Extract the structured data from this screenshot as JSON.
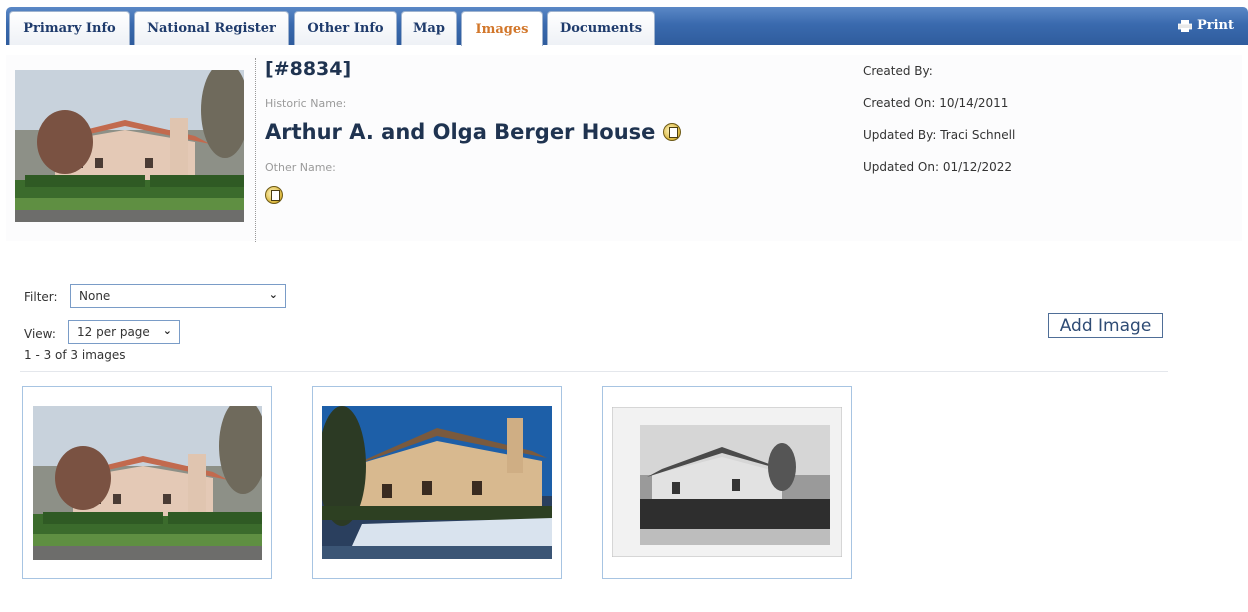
{
  "tabs": [
    {
      "label": "Primary Info"
    },
    {
      "label": "National Register"
    },
    {
      "label": "Other Info"
    },
    {
      "label": "Map"
    },
    {
      "label": "Images",
      "active": true
    },
    {
      "label": "Documents"
    }
  ],
  "print_label": "Print",
  "record": {
    "id": "[#8834]",
    "historic_name_label": "Historic Name:",
    "historic_name": "Arthur A. and Olga Berger House",
    "other_name_label": "Other Name:"
  },
  "meta": {
    "created_by_label": "Created By:",
    "created_by": "",
    "created_on_label": "Created On:",
    "created_on": "10/14/2011",
    "updated_by_label": "Updated By:",
    "updated_by": "Traci Schnell",
    "updated_on_label": "Updated On:",
    "updated_on": "01/12/2022"
  },
  "controls": {
    "filter_label": "Filter:",
    "filter_value": "None",
    "view_label": "View:",
    "view_value": "12 per page",
    "count_text": "1 - 3 of 3 images",
    "add_image_label": "Add Image"
  },
  "gallery": [
    {
      "icon": "house-color-photo-1"
    },
    {
      "icon": "house-color-photo-2"
    },
    {
      "icon": "house-bw-photo"
    }
  ],
  "colors": {
    "tabbar": "#3a6aae",
    "active_tab_text": "#d2772b",
    "tab_text": "#1f3b6c",
    "card_border": "#a7c4e2"
  }
}
